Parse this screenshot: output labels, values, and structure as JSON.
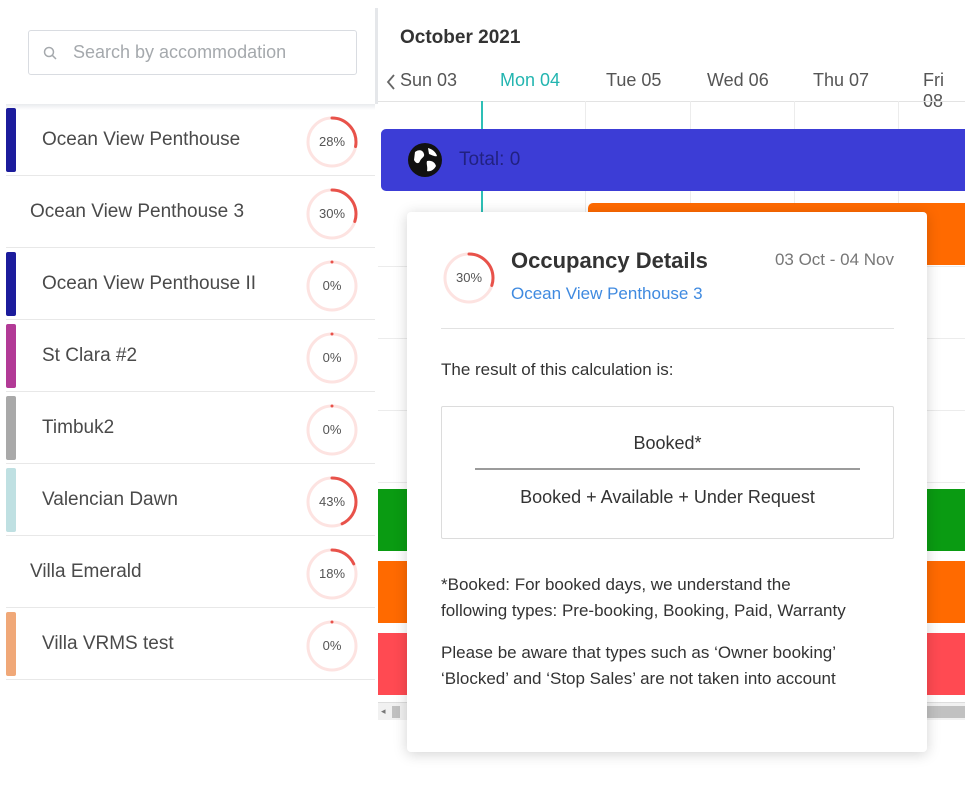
{
  "search": {
    "placeholder": "Search by accommodation"
  },
  "accommodations": [
    {
      "name": "Ocean View Penthouse",
      "occupancy": "28%",
      "pct": 28,
      "color": "#1c1c9c"
    },
    {
      "name": "Ocean View Penthouse 3",
      "occupancy": "30%",
      "pct": 30,
      "color": ""
    },
    {
      "name": "Ocean View Penthouse II",
      "occupancy": "0%",
      "pct": 0,
      "color": "#1c1c9c"
    },
    {
      "name": "St Clara #2",
      "occupancy": "0%",
      "pct": 0,
      "color": "#b23a96"
    },
    {
      "name": "Timbuk2",
      "occupancy": "0%",
      "pct": 0,
      "color": "#a9a9a9"
    },
    {
      "name": "Valencian Dawn",
      "occupancy": "43%",
      "pct": 43,
      "color": "#bfe0e2"
    },
    {
      "name": "Villa Emerald",
      "occupancy": "18%",
      "pct": 18,
      "color": ""
    },
    {
      "name": "Villa VRMS test",
      "occupancy": "0%",
      "pct": 0,
      "color": "#f0a878"
    }
  ],
  "calendar": {
    "month": "October 2021",
    "days": [
      "Sun 03",
      "Mon 04",
      "Tue 05",
      "Wed 06",
      "Thu 07",
      "Fri 08"
    ],
    "active_day": "Mon 04",
    "total_label": "Total: 0"
  },
  "popover": {
    "title": "Occupancy Details",
    "accommodation": "Ocean View Penthouse 3",
    "date_range": "03 Oct - 04 Nov",
    "occupancy": "30%",
    "occupancy_pct": 30,
    "result_intro": "The result of this calculation is:",
    "numerator": "Booked*",
    "denominator": "Booked + Available + Under Request",
    "note_1_line_1": "*Booked: For booked days, we understand the",
    "note_1_line_2": "following types: Pre-booking, Booking, Paid, Warranty",
    "note_2_line_1": "Please be aware that types such as ‘Owner booking’",
    "note_2_line_2": "‘Blocked’ and ‘Stop Sales’ are not taken into account"
  },
  "colors": {
    "accent_teal": "#23b5b0",
    "total_bar": "#3c3dd6",
    "ring": "#e8524a",
    "ring_track": "#fde3e1",
    "booking_orange": "#ff6a00",
    "booking_green": "#0a9b12",
    "booking_red": "#ff4a52",
    "link_blue": "#3f8ae0"
  }
}
